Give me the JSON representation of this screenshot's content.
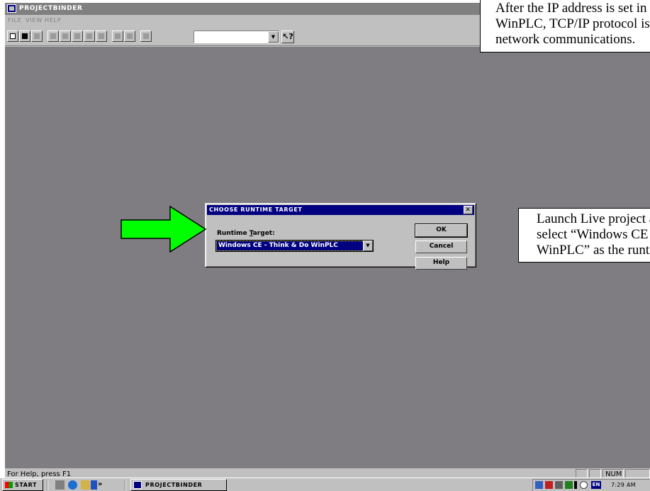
{
  "window": {
    "title": "ProjectBinder"
  },
  "menu": {
    "items": [
      "File",
      "View",
      "Help"
    ]
  },
  "toolbar": {
    "buttons": [
      {
        "icon": "new-file-icon",
        "state": "enabled"
      },
      {
        "icon": "open-folder-icon",
        "state": "enabled"
      },
      {
        "icon": "save-icon",
        "state": "disabled"
      },
      {
        "icon": "build-icon",
        "state": "disabled"
      },
      {
        "icon": "compile-icon",
        "state": "disabled"
      },
      {
        "icon": "download-icon",
        "state": "disabled"
      },
      {
        "icon": "monitor-icon",
        "state": "disabled"
      },
      {
        "icon": "find-icon",
        "state": "disabled"
      },
      {
        "icon": "print-icon",
        "state": "disabled"
      },
      {
        "icon": "chart-icon",
        "state": "disabled"
      },
      {
        "icon": "run-icon",
        "state": "disabled"
      }
    ],
    "combo_value": "",
    "help_pointer_icon": "help-pointer-icon"
  },
  "status": {
    "text": "For Help, press F1",
    "num": "NUM"
  },
  "dialog": {
    "title": "Choose Runtime Target",
    "label_prefix": "Runtime ",
    "label_accel": "T",
    "label_suffix": "arget:",
    "selected": "Windows CE - Think & Do WinPLC",
    "buttons": {
      "ok": "OK",
      "cancel": "Cancel",
      "help": "Help"
    },
    "close_icon": "close-icon"
  },
  "taskbar": {
    "start": "Start",
    "task": "ProjectBinder",
    "quicklaunch_more": "»",
    "lang": "EN",
    "clock": "7:29 AM"
  },
  "annotations": {
    "top_lines": [
      "After the IP address is set in the",
      "WinPLC, TCP/IP protocol is used for",
      "network communications."
    ],
    "mid_lines": [
      "Launch Live project and",
      "select “Windows CE - Think & Do",
      "WinPLC” as the runtime target."
    ]
  },
  "colors": {
    "desktop": "#7f7d82",
    "face": "#c0c0c0",
    "dialog_title": "#000080",
    "selection": "#000080",
    "arrow": "#00ff00"
  }
}
